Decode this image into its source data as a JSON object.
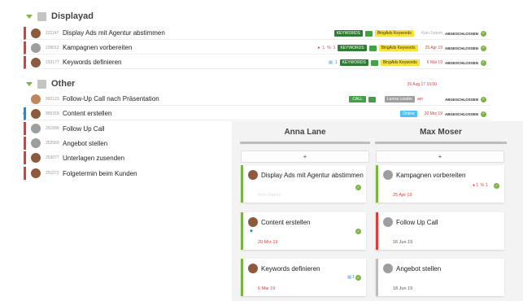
{
  "sections": [
    {
      "title": "Displayad"
    },
    {
      "title": "Other"
    }
  ],
  "rows": [
    {
      "num": "231147",
      "name": "Display Ads mit Agentur abstimmen",
      "kw": "KEYWORDS",
      "ba": "BingAds Keywords",
      "date": "Kein Datum",
      "status": "ABGESCHLOSSEN"
    },
    {
      "num": "228012",
      "name": "Kampagnen vorbereiten",
      "hot": "1",
      "pct": "1",
      "kw": "KEYWORDS",
      "ba": "BingAds Keywords",
      "date": "25 Apr 19",
      "status": "ABGESCHLOSSEN"
    },
    {
      "num": "233177",
      "name": "Keywords definieren",
      "count": "1",
      "kw": "KEYWORDS",
      "ba": "BingAds Keywords",
      "date": "6 Mai 19",
      "status": "ABGESCHLOSSEN"
    },
    {
      "num": "992123",
      "name": "Follow-Up Call nach Präsentation",
      "call": "CALL",
      "lead": "Lamra Leader",
      "am": "am",
      "date": "29 Aug 17 10:00",
      "status": "ABGESCHLOSSEN"
    },
    {
      "num": "995318",
      "name": "Content erstellen",
      "online": "Online",
      "date": "20 Mrz 19",
      "status": "ABGESCHLOSSEN"
    },
    {
      "num": "251586",
      "name": "Follow Up Call"
    },
    {
      "num": "252069",
      "name": "Angebot stellen"
    },
    {
      "num": "253077",
      "name": "Unterlagen zusenden"
    },
    {
      "num": "251072",
      "name": "Folgetermin beim Kunden"
    }
  ],
  "board": {
    "columns": [
      {
        "name": "Anna Lane",
        "add": "+",
        "cards": [
          {
            "title": "Display Ads mit Agentur abstimmen",
            "date": "Kein Datum"
          },
          {
            "title": "Content erstellen",
            "date": "20 Mrz 19"
          },
          {
            "title": "Keywords definieren",
            "count": "1",
            "date": "6 Mai 19"
          }
        ]
      },
      {
        "name": "Max Moser",
        "add": "+",
        "cards": [
          {
            "title": "Kampagnen vorbereiten",
            "hot": "1",
            "pct": "1",
            "date": "25 Apr 19"
          },
          {
            "title": "Follow Up Call",
            "date": "16 Jun 19"
          },
          {
            "title": "Angebot stellen",
            "date": "18 Jun 19"
          }
        ]
      }
    ]
  },
  "colors": {
    "green": "#7cb342",
    "red": "#e53935",
    "grey": "#bdbdbd",
    "blue": "#1e88e5"
  }
}
